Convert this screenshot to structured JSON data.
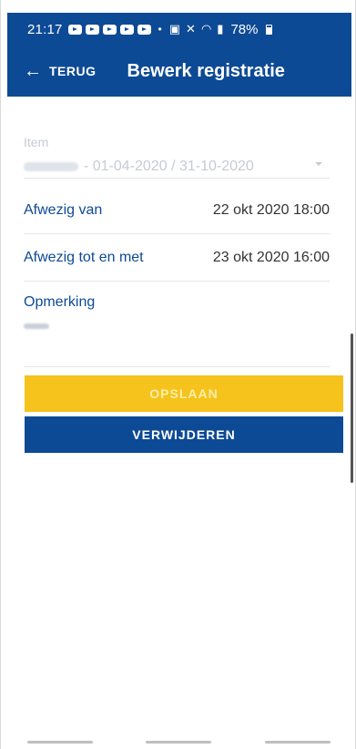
{
  "status_bar": {
    "time": "21:17",
    "battery": "78%"
  },
  "app_bar": {
    "back_label": "TERUG",
    "title": "Bewerk registratie"
  },
  "form": {
    "item_label": "Item",
    "item_value_dates": "- 01-04-2020 / 31-10-2020",
    "rows": [
      {
        "label": "Afwezig van",
        "value": "22 okt 2020 18:00"
      },
      {
        "label": "Afwezig tot en met",
        "value": "23 okt 2020 16:00"
      }
    ],
    "remark_label": "Opmerking"
  },
  "buttons": {
    "save_label": "OPSLAAN",
    "delete_label": "VERWIJDEREN"
  },
  "colors": {
    "primary": "#0d4a95",
    "accent": "#f5c31c"
  }
}
